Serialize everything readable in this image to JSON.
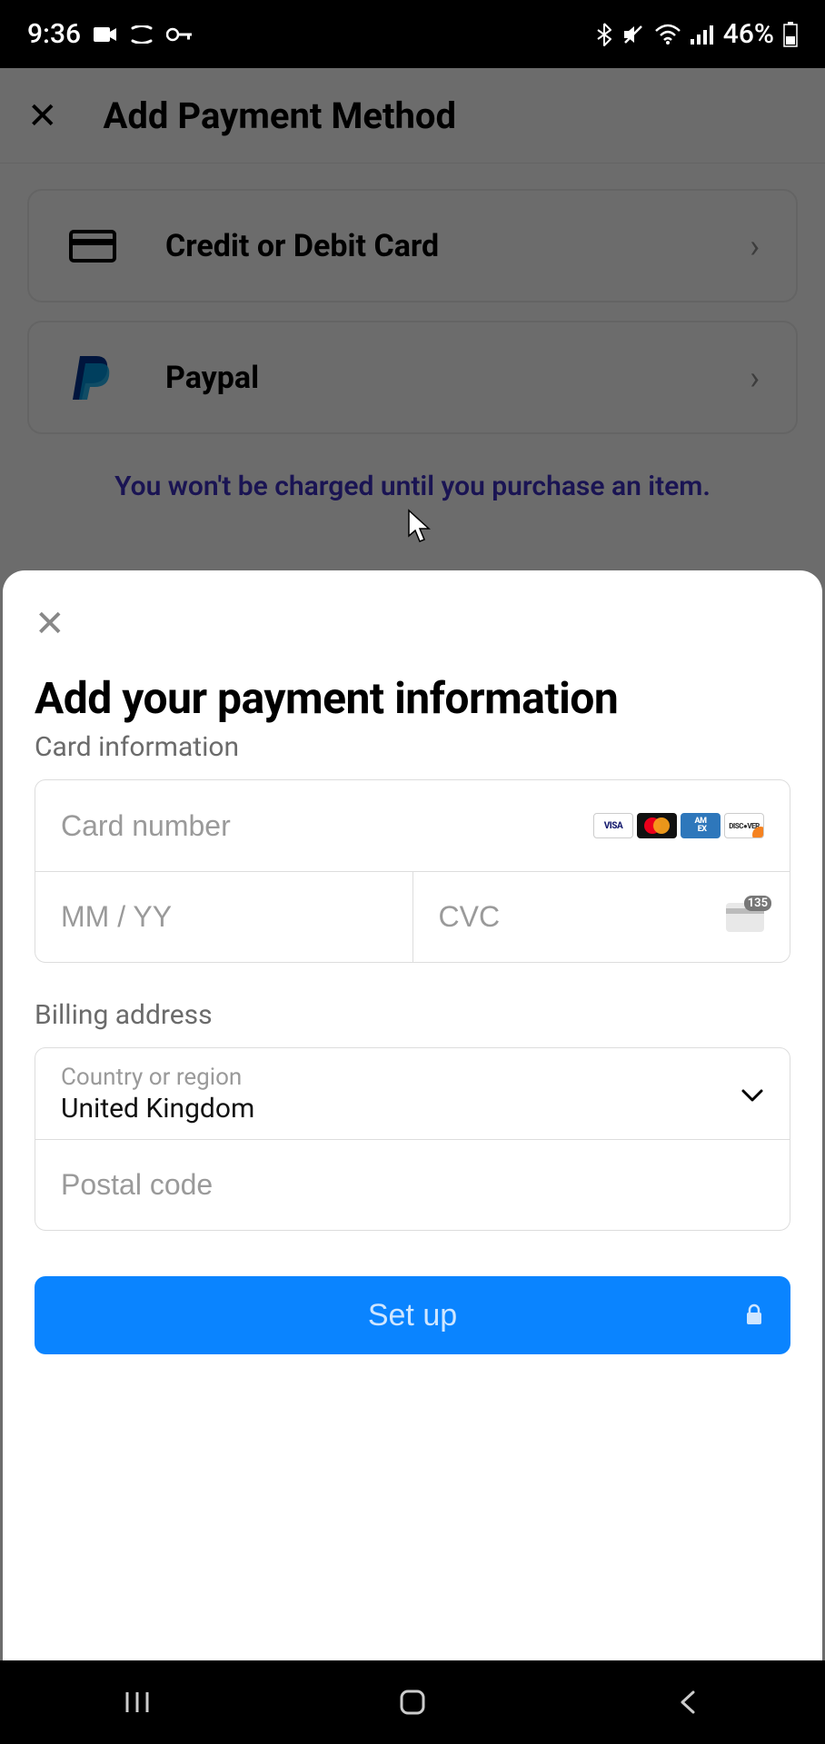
{
  "status": {
    "time": "9:36",
    "battery": "46%"
  },
  "bg": {
    "title": "Add Payment Method",
    "options": [
      {
        "label": "Credit or Debit Card"
      },
      {
        "label": "Paypal"
      }
    ],
    "hint": "You won't be charged until you purchase an item."
  },
  "sheet": {
    "title": "Add your payment information",
    "card_section_label": "Card information",
    "card_number_placeholder": "Card number",
    "expiry_placeholder": "MM / YY",
    "cvc_placeholder": "CVC",
    "cvc_badge": "135",
    "billing_section_label": "Billing address",
    "country_label": "Country or region",
    "country_value": "United Kingdom",
    "postal_placeholder": "Postal code",
    "submit_label": "Set up"
  }
}
